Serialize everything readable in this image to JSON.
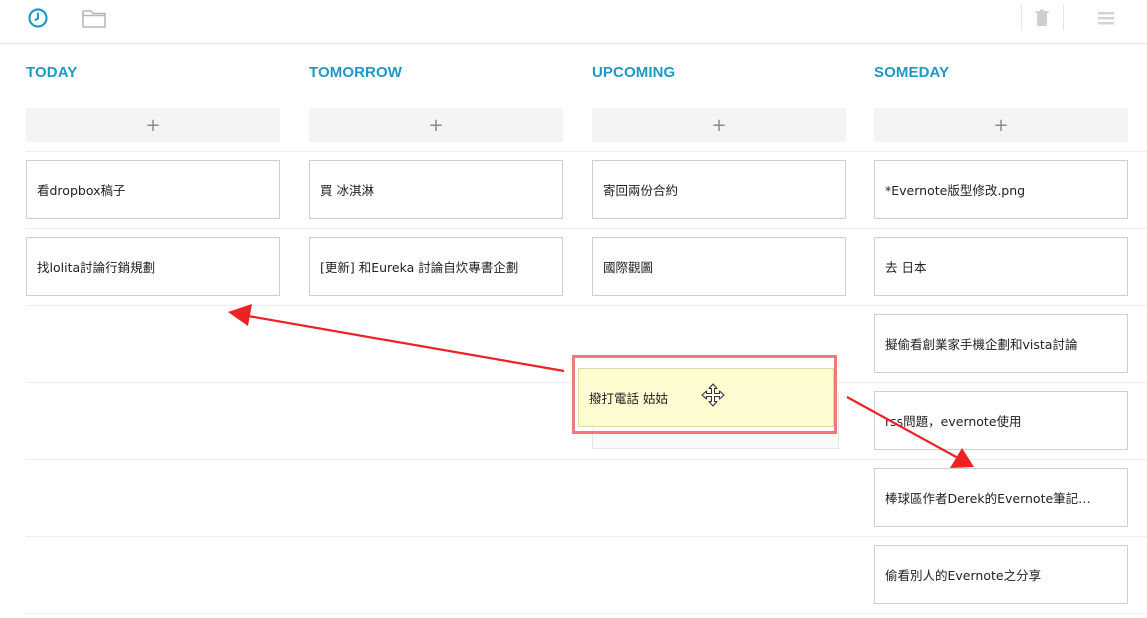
{
  "toolbar": {
    "icons": [
      "clock-icon",
      "folder-icon",
      "trash-icon",
      "menu-icon"
    ],
    "accent_color": "#1e98c8"
  },
  "columns": [
    {
      "title": "TODAY",
      "add_label": "+",
      "cards": [
        "看dropbox稿子",
        "找lolita討論行銷規劃"
      ]
    },
    {
      "title": "TOMORROW",
      "add_label": "+",
      "cards": [
        "買 冰淇淋",
        "[更新] 和Eureka 討論自炊專書企劃"
      ]
    },
    {
      "title": "UPCOMING",
      "add_label": "+",
      "cards": [
        "寄回兩份合約",
        "國際觀圖"
      ]
    },
    {
      "title": "SOMEDAY",
      "add_label": "+",
      "cards": [
        "*Evernote版型修改.png",
        "去 日本",
        "擬偷看創業家手機企劃和vista討論",
        "rss問題，evernote使用",
        "棒球區作者Derek的Evernote筆記…",
        "偷看別人的Evernote之分享"
      ]
    }
  ],
  "dragging_card": {
    "label": "撥打電話 姑姑"
  },
  "annotation_color": "#ee2222"
}
